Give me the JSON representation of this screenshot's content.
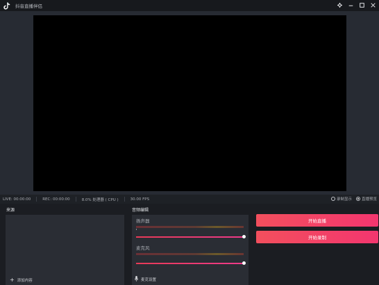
{
  "window": {
    "title": "抖音直播伴侣",
    "controls": [
      "gear-icon",
      "minimize-icon",
      "maximize-icon",
      "close-icon"
    ]
  },
  "status": {
    "live": "LIVE: 00:00:00",
    "rec": "REC: 00:00:00",
    "cpu": "8.0% 处理器 ( CPU )",
    "fps": "30.00 FPS",
    "radio_options": [
      {
        "label": "录制显示",
        "selected": false
      },
      {
        "label": "直播预览",
        "selected": true
      }
    ]
  },
  "sources": {
    "title": "来源",
    "add_label": "添加内容"
  },
  "mixer": {
    "title": "音频编辑",
    "speaker_label": "扬声器",
    "speaker_volume": 1.0,
    "mic_label": "麦克风",
    "mic_volume": 1.0,
    "mic_settings_label": "麦克设置"
  },
  "actions": {
    "start_live": "开始直播",
    "start_record": "开始录制"
  },
  "colors": {
    "accent": "#f3366f",
    "panel": "#2a2d34",
    "background": "#1b1d22"
  }
}
